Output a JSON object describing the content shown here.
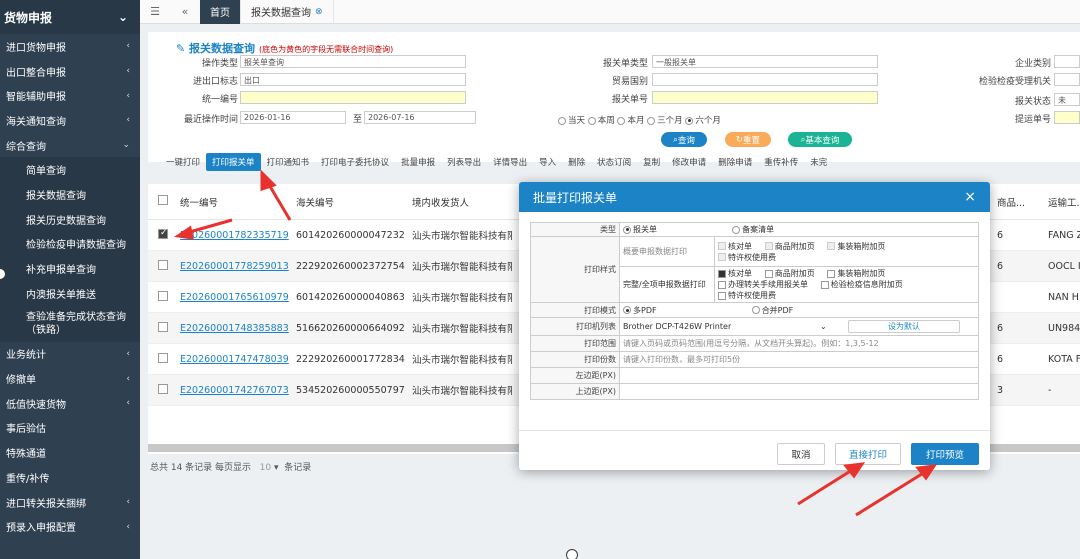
{
  "sidebar": {
    "header": "货物申报",
    "items": [
      {
        "label": "进口货物申报",
        "chev": "‹"
      },
      {
        "label": "出口整合申报",
        "chev": "‹"
      },
      {
        "label": "智能辅助申报",
        "chev": "‹"
      },
      {
        "label": "海关通知查询",
        "chev": "‹"
      },
      {
        "label": "综合查询",
        "chev": "⌄"
      }
    ],
    "sub": [
      "简单查询",
      "报关数据查询",
      "报关历史数据查询",
      "检验检疫申请数据查询",
      "补充申报单查询",
      "内澳报关单推送",
      "查验准备完成状态查询（铁路）"
    ],
    "items2": [
      {
        "label": "业务统计",
        "chev": "‹"
      },
      {
        "label": "修撤单",
        "chev": "‹"
      },
      {
        "label": "低值快速货物",
        "chev": "‹"
      },
      {
        "label": "事后验估",
        "chev": ""
      },
      {
        "label": "特殊通道",
        "chev": ""
      },
      {
        "label": "重传/补传",
        "chev": ""
      },
      {
        "label": "进口转关报关捆绑",
        "chev": "‹"
      },
      {
        "label": "预录入申报配置",
        "chev": "‹"
      }
    ]
  },
  "tabs": {
    "home": "首页",
    "current": "报关数据查询"
  },
  "form": {
    "title": "报关数据查询",
    "hint": "(底色为黄色的字段无需联合时间查询)",
    "op_type_label": "操作类型",
    "op_type": "报关单查询",
    "ie_label": "进出口标志",
    "ie": "出口",
    "uni_label": "统一编号",
    "date_label": "最近操作时间",
    "date_from": "2026-01-16",
    "to_label": "至",
    "date_to": "2026-07-16",
    "decl_type_label": "报关单类型",
    "decl_type": "一般报关单",
    "trade_label": "贸易国别",
    "decl_no_label": "报关单号",
    "ent_label": "企业类别",
    "insp_label": "检验检疫受理机关",
    "status_label": "报关状态",
    "status": "未",
    "bill_label": "提运单号",
    "radios": [
      "当天",
      "本周",
      "本月",
      "三个月",
      "六个月"
    ],
    "btn_query": "查询",
    "btn_reset": "重置",
    "btn_adv": "基本查询"
  },
  "toolbar": [
    "一键打印",
    "打印报关单",
    "打印通知书",
    "打印电子委托协议",
    "批量申报",
    "列表导出",
    "详情导出",
    "导入",
    "删除",
    "状态订阅",
    "复制",
    "修改申请",
    "删除申请",
    "重传补传",
    "未完"
  ],
  "table": {
    "headers": [
      "统一编号",
      "海关编号",
      "境内收发货人",
      "商品...",
      "运输工..."
    ],
    "rows": [
      {
        "no": "E20260001782335719",
        "cus": "601420260000047232",
        "rec": "汕头市瑞尔智能科技有限",
        "r1": "6",
        "r2": "FANG Z",
        "checked": true
      },
      {
        "no": "E20260001778259013",
        "cus": "222920260002372754",
        "rec": "汕头市瑞尔智能科技有限",
        "r1": "6",
        "r2": "OOCL I",
        "checked": false
      },
      {
        "no": "E20260001765610979",
        "cus": "601420260000040863",
        "rec": "汕头市瑞尔智能科技有限",
        "r1": "",
        "r2": "NAN H",
        "checked": false
      },
      {
        "no": "E20260001748385883",
        "cus": "516620260000664092",
        "rec": "汕头市瑞尔智能科技有限",
        "r1": "6",
        "r2": "UN984",
        "checked": false
      },
      {
        "no": "E20260001747478039",
        "cus": "222920260001772834",
        "rec": "汕头市瑞尔智能科技有限",
        "r1": "6",
        "r2": "KOTA F",
        "checked": false
      },
      {
        "no": "E20260001742767073",
        "cus": "534520260000550797",
        "rec": "汕头市瑞尔智能科技有限",
        "r1": "3",
        "r2": "-",
        "checked": false
      }
    ],
    "footer_total": "总共 14 条记录 每页显示",
    "footer_size": "10",
    "footer_unit": "条记录"
  },
  "modal": {
    "title": "批量打印报关单",
    "close": "×",
    "type_label": "类型",
    "type_opt1": "报关单",
    "type_opt2": "备案清单",
    "style_label": "打印样式",
    "summary_label": "概要申报数据打印",
    "s_check": "核对单",
    "s_attach": "商品附加页",
    "s_box": "集装箱附加页",
    "s_priv": "特许权使用费",
    "full_label": "完整/全项申报数据打印",
    "f_check": "核对单",
    "f_attach": "商品附加页",
    "f_box": "集装箱附加页",
    "f_handbook": "办理转关手续用报关单",
    "f_insp": "检验检疫信息附加页",
    "f_priv": "特许权使用费",
    "mode_label": "打印模式",
    "mode_opt1": "多PDF",
    "mode_opt2": "合并PDF",
    "printer_label": "打印机列表",
    "printer": "Brother DCP-T426W Printer",
    "default_btn": "设为默认",
    "range_label": "打印范围",
    "range_ph": "请键入页码或页码范围(用逗号分隔，从文档开头算起)。例如：1,3,5-12",
    "copies_label": "打印份数",
    "copies_ph": "请键入打印份数，最多可打印5份",
    "left_label": "左边距(PX)",
    "top_label": "上边距(PX)",
    "btn_cancel": "取消",
    "btn_direct": "直接打印",
    "btn_preview": "打印预览"
  }
}
